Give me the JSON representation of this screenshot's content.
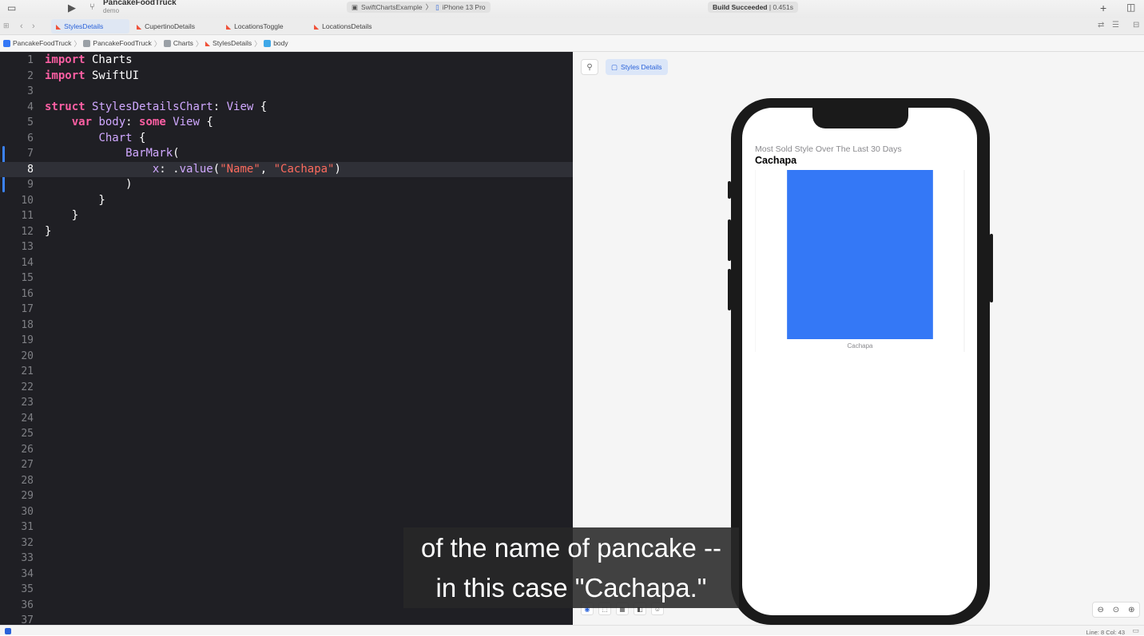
{
  "toolbar": {
    "project_name": "PancakeFoodTruck",
    "branch": "demo",
    "scheme": "SwiftChartsExample",
    "device": "iPhone 13 Pro",
    "build_status_bold": "Build Succeeded",
    "build_time": "| 0.451s"
  },
  "tabs": [
    {
      "label": "StylesDetails",
      "active": true
    },
    {
      "label": "CupertinoDetails",
      "active": false
    },
    {
      "label": "LocationsToggle",
      "active": false
    },
    {
      "label": "LocationsDetails",
      "active": false
    }
  ],
  "breadcrumb": [
    "PancakeFoodTruck",
    "PancakeFoodTruck",
    "Charts",
    "StylesDetails",
    "body"
  ],
  "editor": {
    "current_line": 8,
    "line_count": 37
  },
  "canvas": {
    "preview_chip": "Styles Details",
    "chart_subtitle": "Most Sold Style Over The Last 30 Days",
    "chart_heading": "Cachapa"
  },
  "chart_data": {
    "type": "bar",
    "categories": [
      "Cachapa"
    ],
    "values": [
      1
    ],
    "color": "#3478f6",
    "ylim": [
      0,
      1
    ]
  },
  "status": {
    "cursor": "Line: 8  Col: 43"
  },
  "caption": {
    "line1": "of the name of pancake --",
    "line2": "in this case \"Cachapa.\""
  }
}
